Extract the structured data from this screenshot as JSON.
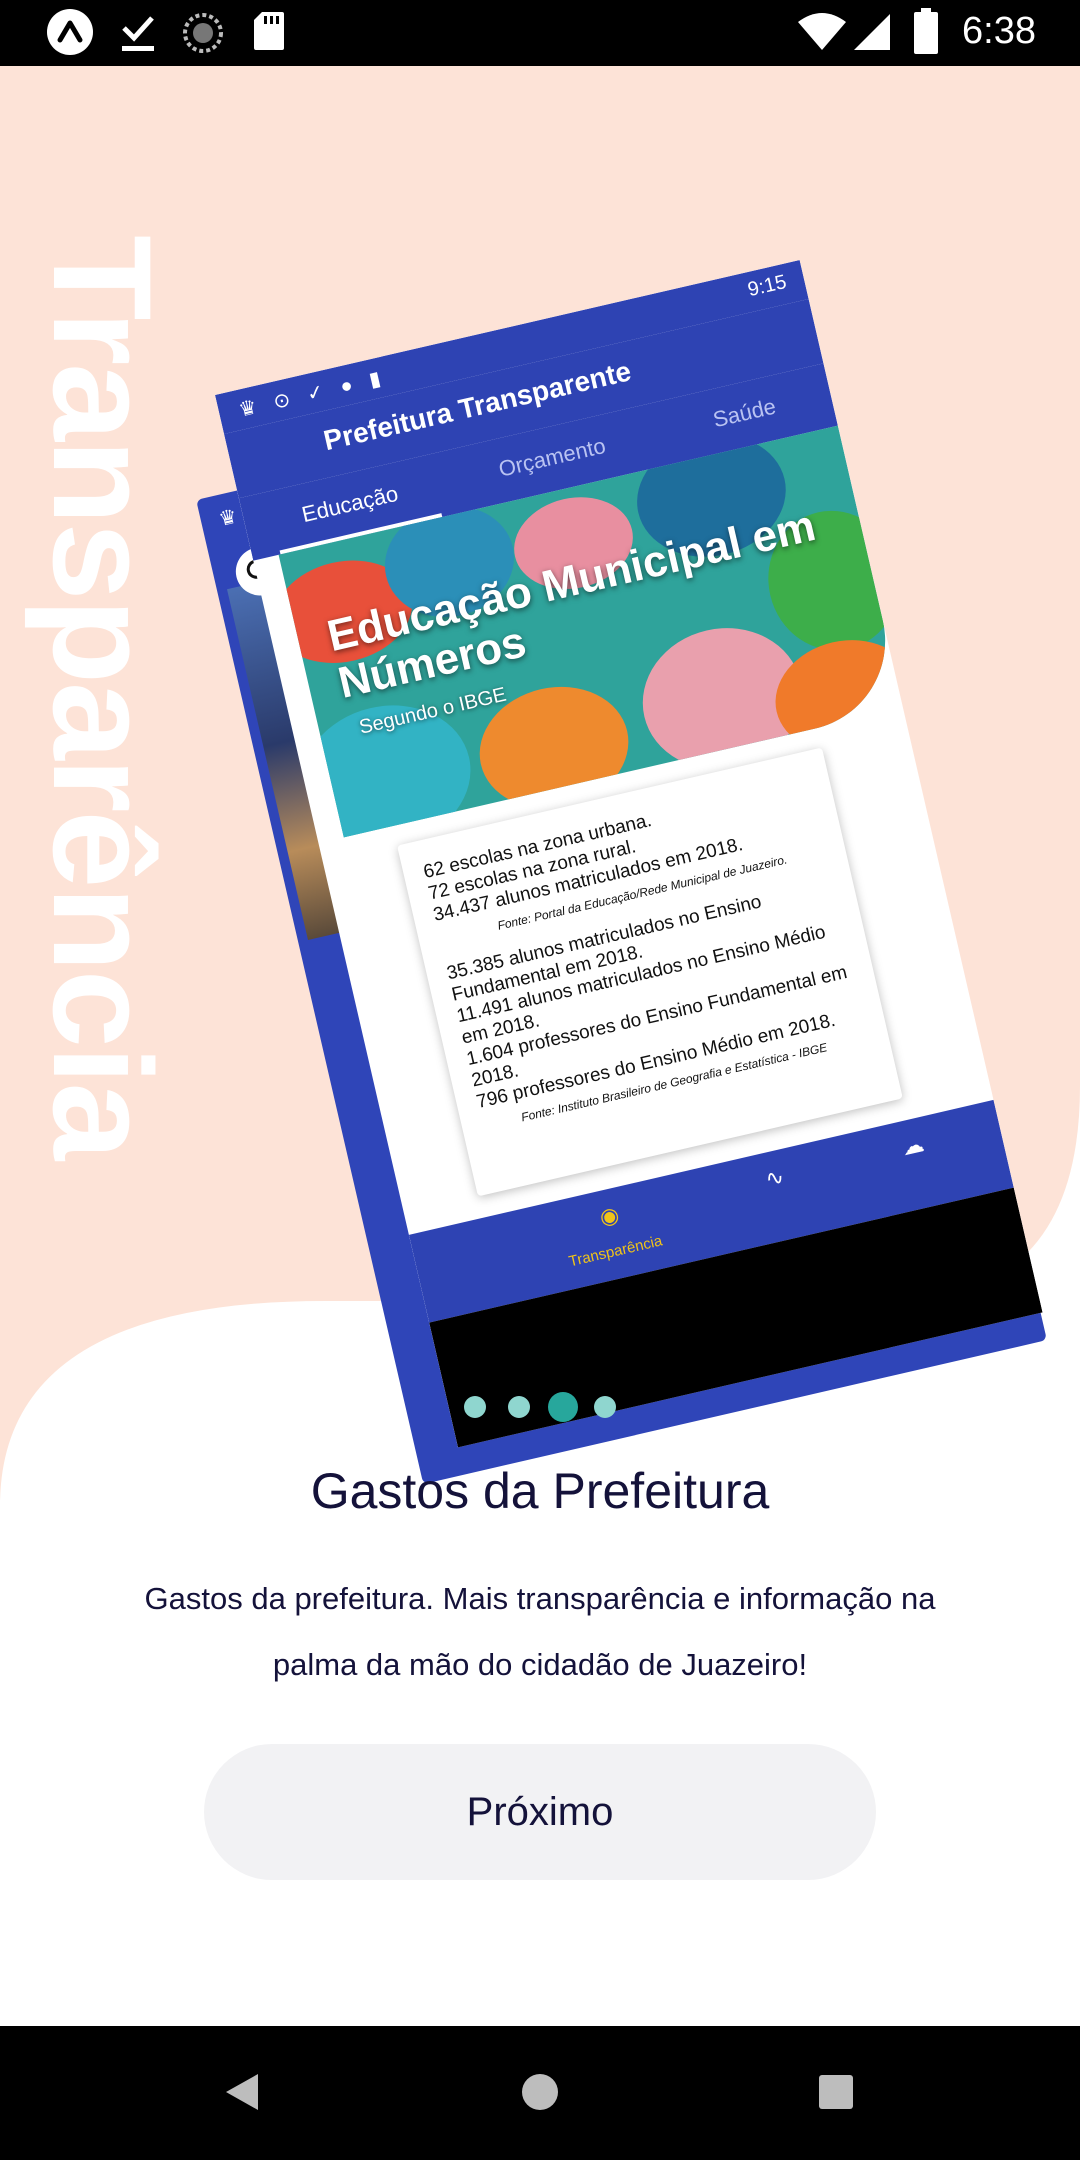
{
  "status_bar": {
    "time": "6:38",
    "icons": [
      "expo-icon",
      "check-download-icon",
      "sync-circle-icon",
      "sd-card-icon",
      "wifi-icon",
      "signal-icon",
      "battery-icon"
    ]
  },
  "side_label": "Transparência",
  "mockup": {
    "status_time": "9:15",
    "app_title": "Prefeitura Transparente",
    "tabs": [
      "Educação",
      "Orçamento",
      "Saúde"
    ],
    "hero_title": "Educação Municipal em Números",
    "hero_subtitle": "Segundo o IBGE",
    "card_lines_1": [
      "62 escolas na zona urbana.",
      "72 escolas na zona rural.",
      "34.437 alunos matriculados em 2018."
    ],
    "source_1": "Fonte: Portal da Educação/Rede Municipal de Juazeiro.",
    "card_lines_2": [
      "35.385 alunos matriculados no Ensino Fundamental em 2018.",
      "11.491 alunos matriculados no Ensino Médio em 2018.",
      "1.604 professores do Ensino Fundamental em 2018.",
      "796 professores do Ensino Médio em 2018."
    ],
    "source_2": "Fonte: Instituto Brasileiro de Geografia e Estatística - IBGE",
    "nav_active_label": "Transparência"
  },
  "pager": {
    "count": 4,
    "active_index": 2
  },
  "heading": "Gastos da Prefeitura",
  "description": "Gastos da prefeitura. Mais transparência e informação na palma da mão do cidadão de Juazeiro!",
  "next_button_label": "Próximo",
  "colors": {
    "peach": "#fde3d7",
    "accent": "#27a79c",
    "dot_inactive": "#8fd6cf",
    "text_dark": "#14123a",
    "app_blue": "#2e43b3"
  }
}
